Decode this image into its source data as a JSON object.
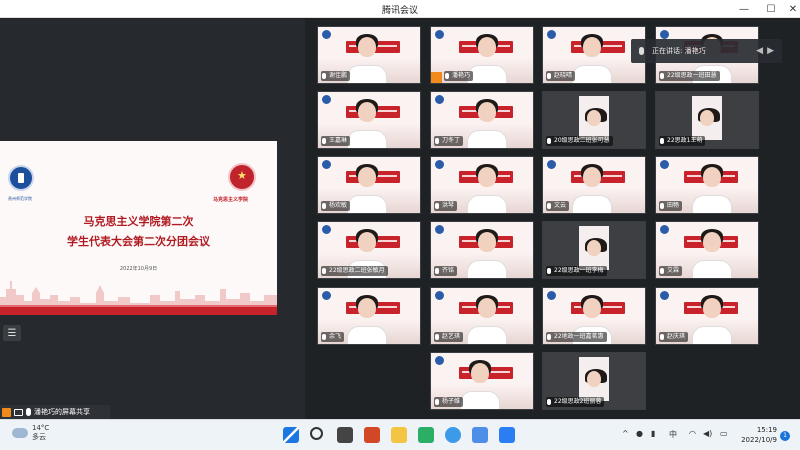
{
  "window": {
    "title": "腾讯会议",
    "minimize": "—",
    "maximize": "☐",
    "close": "✕"
  },
  "slide": {
    "left_logo_text": "贵州师范学院",
    "right_logo_text": "马克思主义学院",
    "title_line1": "马克思主义学院第二次",
    "title_line2": "学生代表大会第二次分团会议",
    "date": "2022年10月9日"
  },
  "speaking": {
    "label": "正在讲话: 潘艳巧"
  },
  "participants": [
    {
      "name": "谢佳鹏",
      "video": true
    },
    {
      "name": "潘艳巧",
      "video": true,
      "host": true
    },
    {
      "name": "赵晓晴",
      "video": true
    },
    {
      "name": "22级思政一班田慧",
      "video": true
    },
    {
      "name": "王嘉琳",
      "video": true
    },
    {
      "name": "刀冬丁",
      "video": true
    },
    {
      "name": "20级思政二班张可慧",
      "video": false
    },
    {
      "name": "22思政1王萌",
      "video": false
    },
    {
      "name": "杨欢敏",
      "video": true
    },
    {
      "name": "洪琴",
      "video": true
    },
    {
      "name": "文云",
      "video": true
    },
    {
      "name": "田畅",
      "video": true
    },
    {
      "name": "22级思政二班张敏月",
      "video": true
    },
    {
      "name": "齐铭",
      "video": true
    },
    {
      "name": "22级思政一班李梅",
      "video": false
    },
    {
      "name": "艾霖",
      "video": true
    },
    {
      "name": "余飞",
      "video": true
    },
    {
      "name": "赵艺琪",
      "video": true
    },
    {
      "name": "22地政一班嘉茗惠",
      "video": true
    },
    {
      "name": "赵庆琪",
      "video": true
    },
    {
      "name": "杨子维",
      "video": true
    },
    {
      "name": "22级思政2班丽蓉",
      "video": false
    }
  ],
  "share_bar": {
    "label": "潘艳巧的屏幕共享"
  },
  "taskbar": {
    "weather_temp": "14°C",
    "weather_desc": "多云",
    "ime": "中",
    "time": "15:19",
    "date": "2022/10/9",
    "notifications": "1"
  }
}
